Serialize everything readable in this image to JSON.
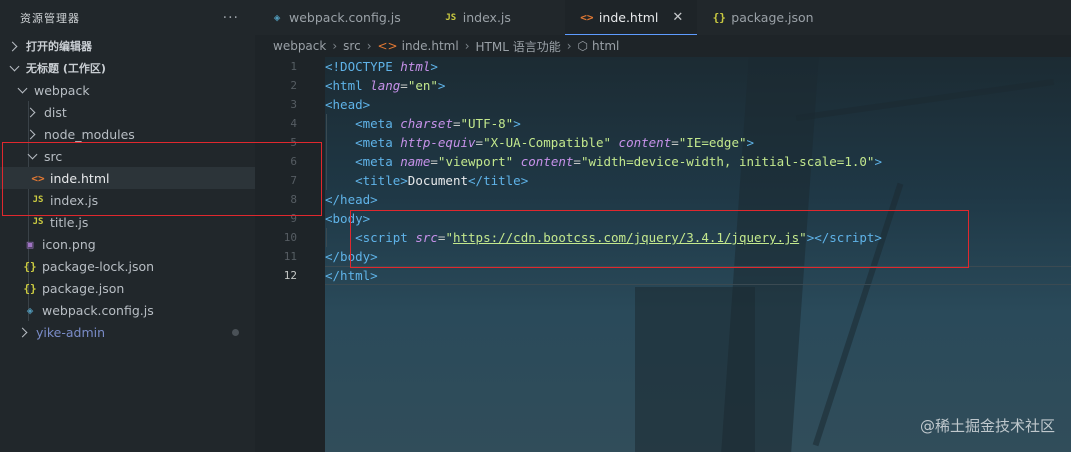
{
  "explorer": {
    "title": "资源管理器",
    "more": "···",
    "open_editors": "打开的编辑器",
    "workspace": "无标题 (工作区)",
    "items": [
      {
        "label": "webpack",
        "icon": "chevron-down",
        "level": 1
      },
      {
        "label": "dist",
        "icon": "chevron-right",
        "level": 2
      },
      {
        "label": "node_modules",
        "icon": "chevron-right",
        "level": 2
      },
      {
        "label": "src",
        "icon": "chevron-down",
        "level": 2
      },
      {
        "label": "inde.html",
        "icon": "html-file-icon",
        "glyph": "<>",
        "level": 3
      },
      {
        "label": "index.js",
        "icon": "js-file-icon",
        "glyph": "JS",
        "level": 3
      },
      {
        "label": "title.js",
        "icon": "js-file-icon",
        "glyph": "JS",
        "level": 3
      },
      {
        "label": "icon.png",
        "icon": "image-file-icon",
        "glyph": "▣",
        "level": 2
      },
      {
        "label": "package-lock.json",
        "icon": "json-file-icon",
        "glyph": "{}",
        "level": 2
      },
      {
        "label": "package.json",
        "icon": "json-file-icon",
        "glyph": "{}",
        "level": 2
      },
      {
        "label": "webpack.config.js",
        "icon": "webpack-file-icon",
        "glyph": "◈",
        "level": 2
      },
      {
        "label": "yike-admin",
        "icon": "chevron-right",
        "level": 0
      }
    ]
  },
  "tabs": [
    {
      "label": "webpack.config.js",
      "glyph": "◈",
      "active": false
    },
    {
      "label": "index.js",
      "glyph": "JS",
      "active": false
    },
    {
      "label": "inde.html",
      "glyph": "<>",
      "active": true,
      "close": "✕"
    },
    {
      "label": "package.json",
      "glyph": "{}",
      "active": false
    }
  ],
  "breadcrumb": [
    "webpack",
    "src",
    "inde.html",
    "HTML 语言功能",
    "html"
  ],
  "editor": {
    "line_numbers": [
      "1",
      "2",
      "3",
      "4",
      "5",
      "6",
      "7",
      "8",
      "9",
      "10",
      "11",
      "12"
    ],
    "current_line": "12"
  },
  "watermark": "@稀土掘金技术社区",
  "colors": {
    "accent": "#5e9cff",
    "highlight_box": "#e0282e"
  }
}
